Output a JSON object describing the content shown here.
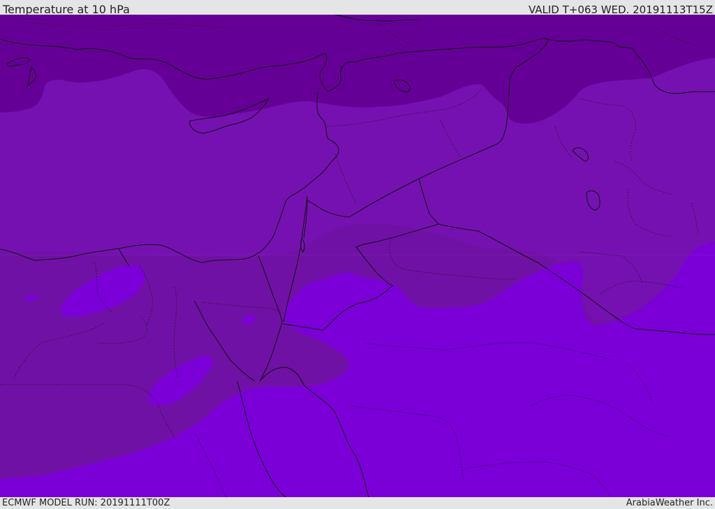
{
  "header": {
    "title": "Temperature at 10 hPa",
    "valid": "VALID T+063 WED. 20191113T15Z"
  },
  "footer": {
    "model_run": "ECMWF MODEL RUN: 20191111T00Z",
    "credit": "ArabiaWeather Inc."
  },
  "colors": {
    "band_coldest": "#650097",
    "band_cold": "#7611b1",
    "band_mid": "#7011a5",
    "band_warm": "#7b00d8",
    "border_line": "#111111",
    "bar_background": "#e5e5e5"
  }
}
